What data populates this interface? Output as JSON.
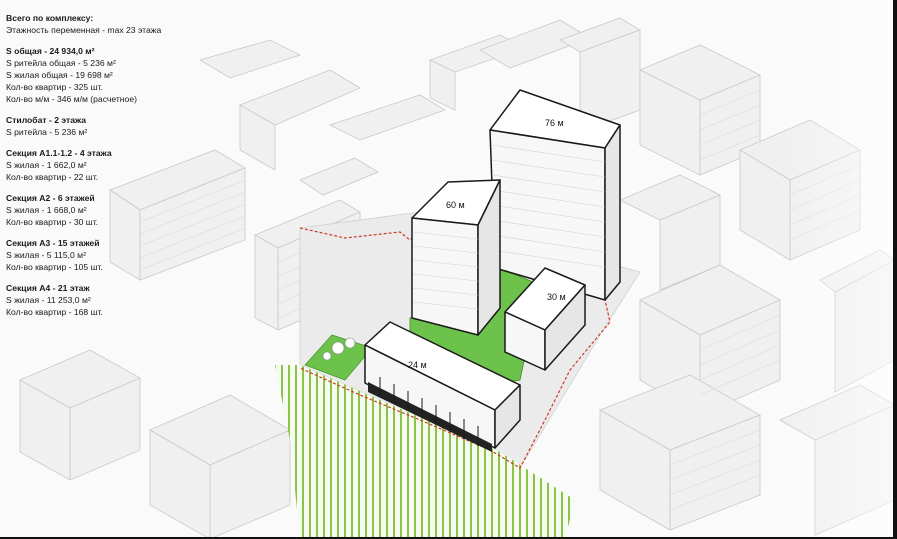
{
  "legend": {
    "total": {
      "title": "Всего по комплексу:",
      "floors": "Этажность переменная - max 23 этажа"
    },
    "areas": {
      "title": "S общая - 24 934,0 м²",
      "lines": [
        "S ритейла общая - 5 236 м²",
        "S жилая общая - 19 698 м²",
        "Кол-во квартир - 325 шт.",
        "Кол-во м/м - 346 м/м (расчетное)"
      ]
    },
    "stylobate": {
      "title": "Стилобат - 2 этажа",
      "lines": [
        "S ритейла - 5 236 м²"
      ]
    },
    "section_a11": {
      "title": "Секция А1.1-1.2 - 4 этажа",
      "lines": [
        "S жилая - 1 662,0 м²",
        "Кол-во квартир - 22 шт."
      ]
    },
    "section_a2": {
      "title": "Секция А2 - 6 этажей",
      "lines": [
        "S жилая - 1 668,0 м²",
        "Кол-во квартир - 30 шт."
      ]
    },
    "section_a3": {
      "title": "Секция А3 - 15 этажей",
      "lines": [
        "S жилая - 5 115,0 м²",
        "Кол-во квартир - 105 шт."
      ]
    },
    "section_a4": {
      "title": "Секция А4 - 21 этаж",
      "lines": [
        "S жилая - 11 253,0 м²",
        "Кол-во квартир - 168 шт."
      ]
    }
  },
  "buildings": {
    "tower_76": "76 м",
    "tower_60": "60 м",
    "block_30": "30 м",
    "podium_24": "24 м"
  },
  "colors": {
    "green_roof": "#6cc24a",
    "boundary": "#d23a2a",
    "hatch": "#8bc34a",
    "outline": "#1a1a1a"
  }
}
